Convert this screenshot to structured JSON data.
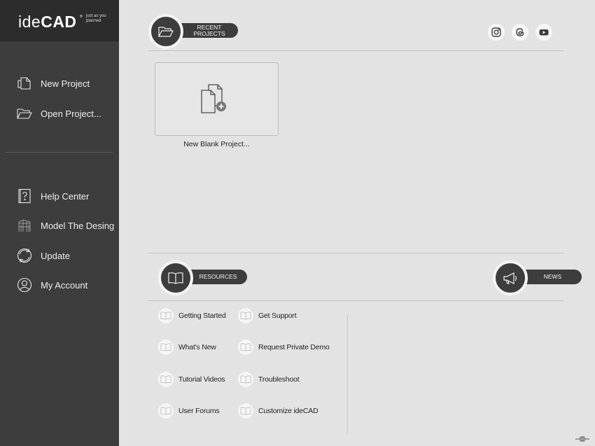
{
  "brand": {
    "name_light": "ide",
    "name_bold": "CAD",
    "registered": "®",
    "tagline": "just as you planned"
  },
  "sidebar": {
    "primary": [
      {
        "label": "New Project",
        "icon": "new-project-icon"
      },
      {
        "label": "Open Project...",
        "icon": "open-folder-icon"
      }
    ],
    "secondary": [
      {
        "label": "Help Center",
        "icon": "help-icon"
      },
      {
        "label": "Model The Desing",
        "icon": "building-model-icon"
      },
      {
        "label": "Update",
        "icon": "update-icon"
      },
      {
        "label": "My Account",
        "icon": "user-icon"
      }
    ]
  },
  "recent": {
    "header": "RECENT PROJECTS",
    "header_line1": "RECENT",
    "header_line2": "PROJECTS",
    "new_blank_label": "New Blank Project..."
  },
  "social": [
    "instagram-icon",
    "threads-icon",
    "youtube-icon"
  ],
  "resources": {
    "header": "RESOURCES",
    "col1": [
      "Getting Started",
      "What's New",
      "Tutorial Videos",
      "User Forums"
    ],
    "col2": [
      "Get Support",
      "Request Private Demo",
      "Troubleshoot",
      "Customize ideCAD"
    ]
  },
  "news": {
    "header": "NEWS"
  },
  "colors": {
    "sidebar": "#3d3d3d",
    "logo_bar": "#2c2c2c",
    "content_bg": "#e3e3e3",
    "accent_circle": "#3d3d3d"
  }
}
